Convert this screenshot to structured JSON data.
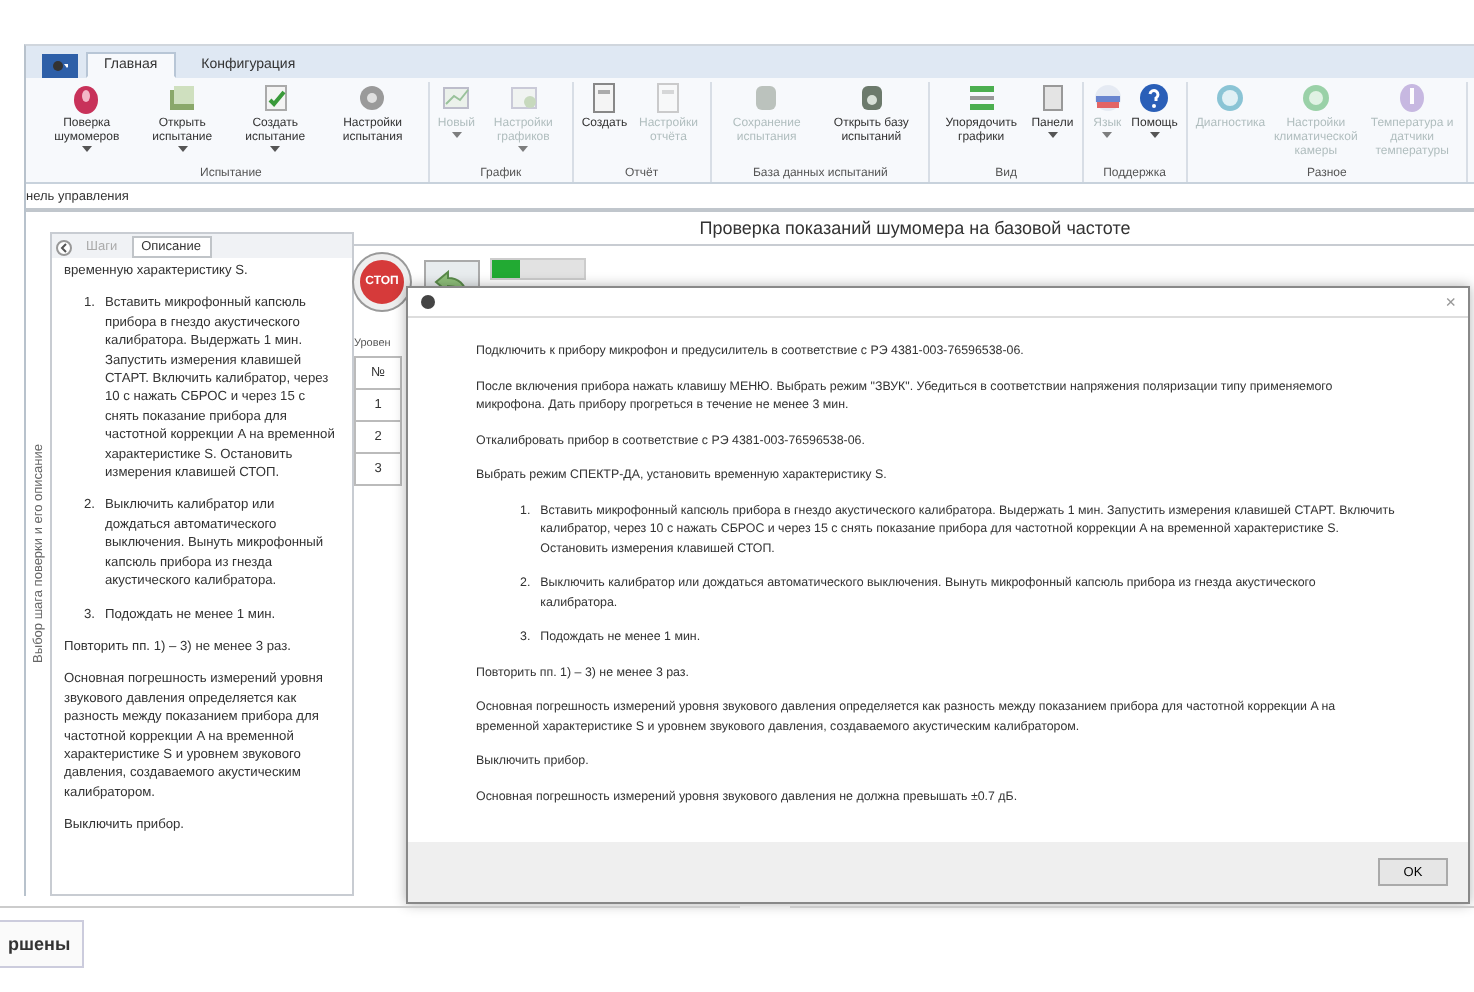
{
  "ribbon": {
    "tabs": [
      {
        "label": "Главная",
        "selected": true
      },
      {
        "label": "Конфигурация",
        "selected": false
      }
    ],
    "groups": [
      {
        "label": "Испытание",
        "buttons": [
          {
            "label": "Поверка шумомеров",
            "dropdown": true,
            "disabled": false
          },
          {
            "label": "Открыть испытание",
            "dropdown": true,
            "disabled": false
          },
          {
            "label": "Создать испытание",
            "dropdown": true,
            "disabled": false
          },
          {
            "label": "Настройки испытания",
            "dropdown": false,
            "disabled": false
          }
        ]
      },
      {
        "label": "График",
        "buttons": [
          {
            "label": "Новый",
            "dropdown": true,
            "disabled": true
          },
          {
            "label": "Настройки графиков",
            "dropdown": true,
            "disabled": true
          }
        ]
      },
      {
        "label": "Отчёт",
        "buttons": [
          {
            "label": "Создать",
            "dropdown": false,
            "disabled": false
          },
          {
            "label": "Настройки отчёта",
            "dropdown": false,
            "disabled": true
          }
        ]
      },
      {
        "label": "База данных испытаний",
        "buttons": [
          {
            "label": "Сохранение испытания",
            "dropdown": false,
            "disabled": true
          },
          {
            "label": "Открыть базу испытаний",
            "dropdown": false,
            "disabled": false
          }
        ]
      },
      {
        "label": "Вид",
        "buttons": [
          {
            "label": "Упорядочить графики",
            "dropdown": false,
            "disabled": false
          },
          {
            "label": "Панели",
            "dropdown": true,
            "disabled": false
          }
        ]
      },
      {
        "label": "Поддержка",
        "buttons": [
          {
            "label": "Язык",
            "dropdown": true,
            "disabled": true
          },
          {
            "label": "Помощь",
            "dropdown": true,
            "disabled": false
          }
        ]
      },
      {
        "label": "Разное",
        "buttons": [
          {
            "label": "Диагностика",
            "dropdown": false,
            "disabled": true
          },
          {
            "label": "Настройки климатической камеры",
            "dropdown": false,
            "disabled": true
          },
          {
            "label": "Температура и датчики температуры",
            "dropdown": false,
            "disabled": true
          }
        ]
      }
    ]
  },
  "panel_title": "нель управления",
  "side_panel": {
    "vertical_label": "Выбор шага поверки и его описание",
    "tabs": [
      {
        "label": "Шаги",
        "selected": false
      },
      {
        "label": "Описание",
        "selected": true
      }
    ],
    "blocks": [
      {
        "kind": "p",
        "text": "временную характеристику S."
      },
      {
        "kind": "item",
        "number": "1.",
        "text": "Вставить микрофонный капсюль прибора в гнездо акустического калибратора. Выдержать 1 мин. Запустить измерения клавишей СТАРТ. Включить калибратор, через 10 с нажать СБРОС и через 15 с снять показание прибора для частотной коррекции A на временной характеристике S. Остановить измерения клавишей СТОП."
      },
      {
        "kind": "item",
        "number": "2.",
        "text": "Выключить калибратор или дождаться автоматического выключения. Вынуть микрофонный капсюль прибора из гнезда акустического калибратора."
      },
      {
        "kind": "item",
        "number": "3.",
        "text": "Подождать не менее 1 мин."
      },
      {
        "kind": "p",
        "text": "Повторить пп. 1) – 3) не менее 3 раз."
      },
      {
        "kind": "p",
        "text": "Основная погрешность измерений уровня звукового давления определяется как разность между показанием прибора для частотной коррекции A на временной характеристике S и уровнем звукового давления, создаваемого акустическим калибратором."
      },
      {
        "kind": "p",
        "text": "Выключить прибор."
      }
    ]
  },
  "main": {
    "title": "Проверка показаний шумомера на базовой частоте",
    "stop_label": "СТОП",
    "progress": {
      "level": 0.3
    },
    "table_caption": "Уровен",
    "table": {
      "header": "№",
      "rows": [
        "1",
        "2",
        "3"
      ]
    }
  },
  "dialog": {
    "close": "×",
    "blocks": [
      {
        "kind": "p",
        "text": "Подключить к прибору микрофон и предусилитель в соответствие с РЭ 4381-003-76596538-06."
      },
      {
        "kind": "p",
        "text": "После включения прибора нажать клавишу МЕНЮ. Выбрать режим \"ЗВУК\". Убедиться в соответствии напряжения поляризации типу применяемого микрофона. Дать прибору прогреться в течение не менее 3 мин."
      },
      {
        "kind": "p",
        "text": "Откалибровать прибор в соответствие с РЭ 4381-003-76596538-06."
      },
      {
        "kind": "p",
        "text": "Выбрать режим СПЕКТР-ДА, установить временную характеристику S."
      },
      {
        "kind": "item",
        "number": "1.",
        "text": "Вставить микрофонный капсюль прибора в гнездо акустического калибратора. Выдержать 1 мин. Запустить измерения клавишей СТАРТ. Включить калибратор, через 10 с нажать СБРОС и через 15 с снять показание прибора для частотной коррекции A на временной характеристике S. Остановить измерения клавишей СТОП."
      },
      {
        "kind": "item",
        "number": "2.",
        "text": "Выключить калибратор или дождаться автоматического выключения. Вынуть микрофонный капсюль прибора из гнезда акустического калибратора."
      },
      {
        "kind": "item",
        "number": "3.",
        "text": "Подождать не менее 1 мин."
      },
      {
        "kind": "p",
        "text": "Повторить пп. 1) – 3) не менее 3 раз."
      },
      {
        "kind": "p",
        "text": "Основная погрешность измерений уровня звукового давления определяется как разность между показанием прибора для частотной коррекции A на временной характеристике S и уровнем звукового давления, создаваемого акустическим калибратором."
      },
      {
        "kind": "p",
        "text": "Выключить прибор."
      },
      {
        "kind": "p",
        "text": "Основная погрешность измерений уровня звукового давления не должна превышать ±0.7 дБ."
      }
    ],
    "ok": "OK"
  },
  "bottom_tab": "ршены"
}
